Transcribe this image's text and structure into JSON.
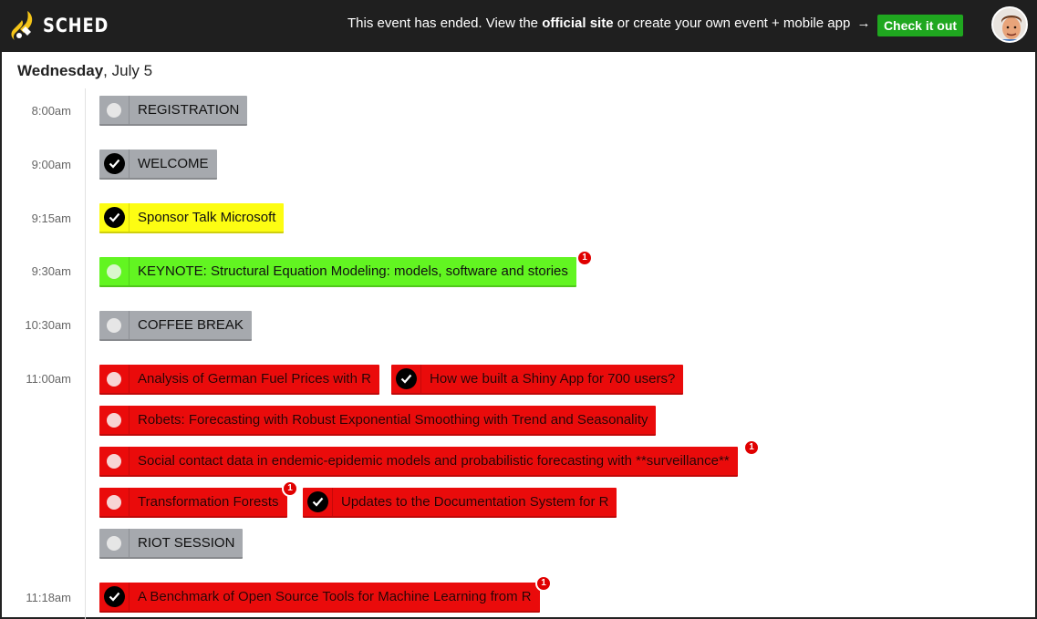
{
  "app": {
    "logo_text": "SCHED",
    "logo_icon": "sched-flame-icon"
  },
  "banner": {
    "prefix": "This event has ended. View the",
    "official_link": "official site",
    "middle": "or create your own event + mobile app",
    "arrow": "→",
    "cta_label": "Check it out",
    "avatar_icon": "user-avatar-icon"
  },
  "day": {
    "weekday": "Wednesday",
    "date": ", July 5"
  },
  "colors": {
    "gray": "#a6a9ae",
    "yellow": "#fdfd12",
    "green": "#62f521",
    "red": "#ea0b0b",
    "cta_green": "#1fa71f"
  },
  "timeslots": [
    {
      "time": "8:00am"
    },
    {
      "time": "9:00am"
    },
    {
      "time": "9:15am"
    },
    {
      "time": "9:30am"
    },
    {
      "time": "10:30am"
    },
    {
      "time": "11:00am"
    },
    {
      "time": "11:18am"
    }
  ],
  "events": [
    {
      "title": "REGISTRATION",
      "selected": false,
      "color": "gray"
    },
    {
      "title": "WELCOME",
      "selected": true,
      "color": "gray"
    },
    {
      "title": "Sponsor Talk Microsoft",
      "selected": true,
      "color": "yellow"
    },
    {
      "title": "KEYNOTE: Structural Equation Modeling: models, software and stories",
      "selected": false,
      "color": "green",
      "badge": "1"
    },
    {
      "title": "COFFEE BREAK",
      "selected": false,
      "color": "gray"
    },
    {
      "title": "Analysis of German Fuel Prices with R",
      "selected": false,
      "color": "red"
    },
    {
      "title": "How we built a Shiny App for 700 users?",
      "selected": true,
      "color": "red"
    },
    {
      "title": "Robets: Forecasting with Robust Exponential Smoothing with Trend and Seasonality",
      "selected": false,
      "color": "red"
    },
    {
      "title": "Social contact data in endemic-epidemic models and probabilistic forecasting with **surveillance**",
      "selected": false,
      "color": "red",
      "badge": "1"
    },
    {
      "title": "Transformation Forests",
      "selected": false,
      "color": "red",
      "badge": "1"
    },
    {
      "title": "Updates to the Documentation System for R",
      "selected": true,
      "color": "red"
    },
    {
      "title": "RIOT SESSION",
      "selected": false,
      "color": "gray"
    },
    {
      "title": "A Benchmark of Open Source Tools for Machine Learning from R",
      "selected": true,
      "color": "red",
      "badge": "1"
    }
  ]
}
